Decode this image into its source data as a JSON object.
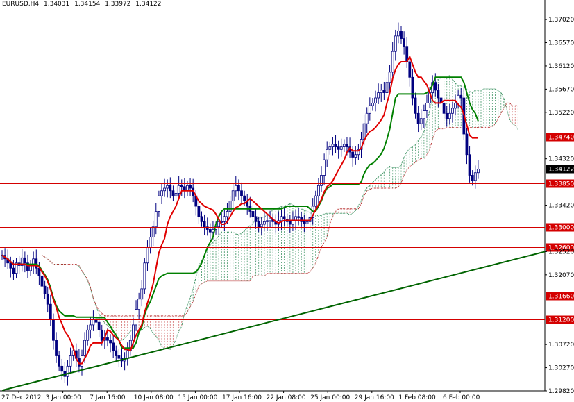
{
  "chart_data": {
    "type": "candlestick",
    "symbol": "EURUSD,H4",
    "ohlc_readout": [
      "1.34031",
      "1.34154",
      "1.33972",
      "1.34122"
    ],
    "price_range": [
      1.2982,
      1.3725
    ],
    "price_ticks": [
      "1.37020",
      "1.36570",
      "1.36120",
      "1.35670",
      "1.35220",
      "1.34740",
      "1.34320",
      "1.34122",
      "1.33850",
      "1.33420",
      "1.33000",
      "1.32600",
      "1.32520",
      "1.32070",
      "1.31660",
      "1.31200",
      "1.30720",
      "1.30270",
      "1.29820"
    ],
    "time_labels": [
      "27 Dec 2012",
      "3 Jan 00:00",
      "7 Jan 16:00",
      "10 Jan 08:00",
      "15 Jan 00:00",
      "17 Jan 16:00",
      "22 Jan 08:00",
      "25 Jan 00:00",
      "29 Jan 16:00",
      "1 Feb 08:00",
      "6 Feb 00:00"
    ],
    "horizontal_levels": [
      {
        "price": "1.34740",
        "color": "#d40000"
      },
      {
        "price": "1.33850",
        "color": "#d40000"
      },
      {
        "price": "1.33000",
        "color": "#d40000"
      },
      {
        "price": "1.32600",
        "color": "#d40000"
      },
      {
        "price": "1.31660",
        "color": "#d40000"
      },
      {
        "price": "1.31200",
        "color": "#d40000"
      }
    ],
    "current_price": {
      "price": "1.34122",
      "color": "#000000"
    },
    "trendline": {
      "from": [
        0,
        1.2983
      ],
      "to": [
        218,
        1.3252
      ],
      "color": "#006400"
    },
    "closes": [
      1.3245,
      1.3238,
      1.323,
      1.322,
      1.321,
      1.323,
      1.3225,
      1.324,
      1.323,
      1.3215,
      1.3225,
      1.3238,
      1.322,
      1.3205,
      1.3185,
      1.317,
      1.315,
      1.312,
      1.308,
      1.305,
      1.303,
      1.302,
      1.301,
      1.303,
      1.305,
      1.306,
      1.3045,
      1.303,
      1.305,
      1.308,
      1.31,
      1.311,
      1.312,
      1.3115,
      1.31,
      1.308,
      1.3085,
      1.308,
      1.3075,
      1.306,
      1.305,
      1.3045,
      1.304,
      1.3045,
      1.306,
      1.308,
      1.311,
      1.314,
      1.316,
      1.318,
      1.323,
      1.326,
      1.328,
      1.33,
      1.333,
      1.336,
      1.337,
      1.3375,
      1.338,
      1.337,
      1.336,
      1.3365,
      1.338,
      1.3378,
      1.337,
      1.338,
      1.3375,
      1.336,
      1.334,
      1.332,
      1.331,
      1.33,
      1.3295,
      1.329,
      1.3295,
      1.33,
      1.331,
      1.331,
      1.332,
      1.333,
      1.335,
      1.337,
      1.338,
      1.337,
      1.336,
      1.335,
      1.334,
      1.333,
      1.332,
      1.331,
      1.33,
      1.3305,
      1.331,
      1.3312,
      1.3315,
      1.331,
      1.3305,
      1.3312,
      1.332,
      1.3315,
      1.331,
      1.3305,
      1.3312,
      1.332,
      1.3318,
      1.331,
      1.3306,
      1.331,
      1.3318,
      1.334,
      1.336,
      1.338,
      1.34,
      1.343,
      1.345,
      1.3455,
      1.346,
      1.3455,
      1.345,
      1.3455,
      1.346,
      1.3455,
      1.3445,
      1.3435,
      1.344,
      1.345,
      1.347,
      1.35,
      1.352,
      1.3535,
      1.354,
      1.355,
      1.356,
      1.3565,
      1.356,
      1.358,
      1.36,
      1.364,
      1.367,
      1.368,
      1.3665,
      1.365,
      1.362,
      1.359,
      1.355,
      1.352,
      1.35,
      1.351,
      1.3525,
      1.354,
      1.356,
      1.358,
      1.3565,
      1.355,
      1.354,
      1.352,
      1.351,
      1.352,
      1.353,
      1.354,
      1.3555,
      1.355,
      1.348,
      1.344,
      1.34,
      1.339,
      1.3405,
      1.3412
    ]
  }
}
